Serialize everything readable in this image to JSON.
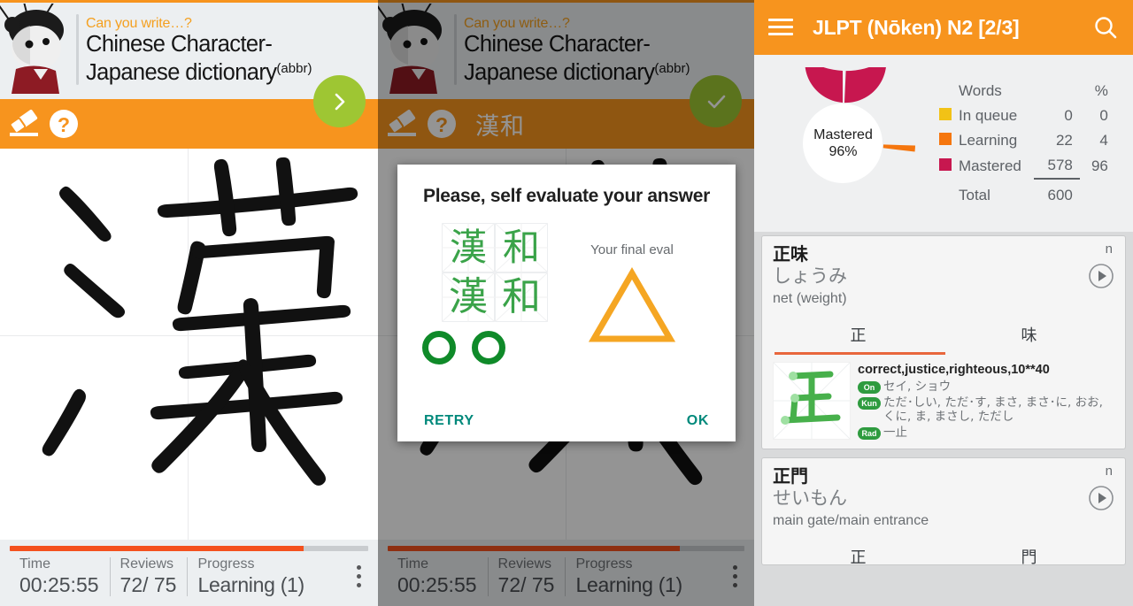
{
  "left_panel": {
    "header": {
      "subtitle": "Can you write…?",
      "title_line1": "Chinese Character-",
      "title_line2": "Japanese dictionary",
      "abbr": "(abbr)"
    },
    "toolbar": {
      "eraser_icon": "eraser-icon",
      "help_icon": "question-mark-icon",
      "prompt": "",
      "fab_icon": "chevron-right-icon"
    },
    "canvas": {
      "drawn_character": "漢"
    },
    "status": {
      "progress_percent": 82,
      "cells": [
        {
          "label": "Time",
          "value": "00:25:55"
        },
        {
          "label": "Reviews",
          "value": "72/ 75"
        },
        {
          "label": "Progress",
          "value": "Learning (1)"
        }
      ],
      "overflow_icon": "kebab-menu-icon"
    }
  },
  "mid_panel": {
    "header": {
      "subtitle": "Can you write…?",
      "title_line1": "Chinese Character-",
      "title_line2": "Japanese dictionary",
      "abbr": "(abbr)"
    },
    "toolbar": {
      "prompt": "漢和",
      "fab_icon": "checkmark-icon"
    },
    "dialog": {
      "title": "Please, self evaluate your answer",
      "rows": [
        {
          "cells": [
            "漢",
            "和"
          ]
        },
        {
          "cells": [
            "漢",
            "和"
          ]
        }
      ],
      "marks": [
        "circle-o",
        "circle-o"
      ],
      "eval_label": "Your final eval",
      "eval_shape": "triangle",
      "eval_color": "#F5A623",
      "retry_label": "RETRY",
      "ok_label": "OK"
    },
    "status": {
      "progress_percent": 82,
      "cells": [
        {
          "label": "Time",
          "value": "00:25:55"
        },
        {
          "label": "Reviews",
          "value": "72/ 75"
        },
        {
          "label": "Progress",
          "value": "Learning (1)"
        }
      ]
    }
  },
  "right_panel": {
    "appbar": {
      "menu_icon": "hamburger-menu-icon",
      "title": "JLPT (Nōken) N2 [2/3]",
      "search_icon": "search-icon"
    },
    "chart_data": {
      "type": "pie",
      "title": "",
      "center_label": "Mastered",
      "center_value": "96%",
      "columns": [
        "",
        "Words",
        "%"
      ],
      "categories": [
        "In queue",
        "Learning",
        "Mastered"
      ],
      "values": [
        0,
        22,
        578
      ],
      "percents": [
        0,
        4,
        96
      ],
      "colors": [
        "#F2C216",
        "#F5760E",
        "#C7174F"
      ],
      "total_label": "Total",
      "total_value": 600,
      "legend_position": "right"
    },
    "cards": [
      {
        "headword": "正味",
        "reading": "しょうみ",
        "meaning": "net (weight)",
        "pos": "n",
        "play_icon": "play-icon",
        "tabs": [
          {
            "label": "正",
            "active": true
          },
          {
            "label": "味",
            "active": false
          }
        ],
        "kanji": {
          "glyph": "正",
          "meanings": "correct,justice,righteous,10**40",
          "readings": [
            {
              "badge": "On",
              "value": "セイ, ショウ"
            },
            {
              "badge": "Kun",
              "value": "ただ･しい, ただ･す, まさ, まさ･に, おお, くに, ま, まさし, ただし"
            },
            {
              "badge": "Rad",
              "value": "一止"
            }
          ]
        }
      },
      {
        "headword": "正門",
        "reading": "せいもん",
        "meaning": "main gate/main entrance",
        "pos": "n",
        "play_icon": "play-icon",
        "tabs": [
          {
            "label": "正",
            "active": true
          },
          {
            "label": "門",
            "active": false
          }
        ]
      }
    ]
  }
}
